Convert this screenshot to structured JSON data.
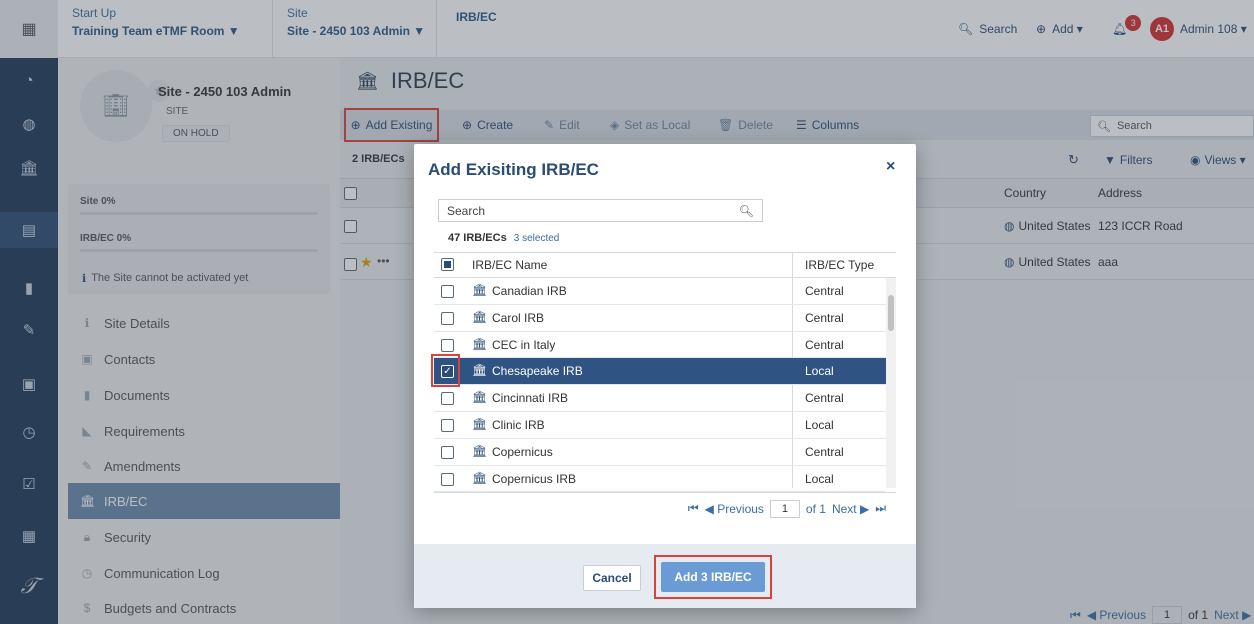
{
  "topbar": {
    "crumbs": [
      {
        "small": "Start Up",
        "big": "Training Team eTMF Room ▼"
      },
      {
        "small": "Site",
        "big": "Site - 2450 103 Admin ▼"
      },
      {
        "small": "",
        "big": "IRB/EC"
      }
    ],
    "search_label": "Search",
    "add_label": "Add ▾",
    "notif_count": "3",
    "avatar_initials": "A1",
    "user_name": "Admin 108 ▾"
  },
  "site": {
    "name": "Site - 2450 103 Admin",
    "type": "SITE",
    "status": "ON HOLD"
  },
  "progress": {
    "site_label": "Site 0%",
    "site_value": 0,
    "irb_label": "IRB/EC 0%",
    "irb_value": 0,
    "notice": "The Site cannot be activated yet"
  },
  "nav": [
    {
      "label": "Site Details",
      "icon": "info-icon"
    },
    {
      "label": "Contacts",
      "icon": "contacts-icon"
    },
    {
      "label": "Documents",
      "icon": "document-icon"
    },
    {
      "label": "Requirements",
      "icon": "tag-icon"
    },
    {
      "label": "Amendments",
      "icon": "edit-icon"
    },
    {
      "label": "IRB/EC",
      "icon": "institution-icon"
    },
    {
      "label": "Security",
      "icon": "lock-icon"
    },
    {
      "label": "Communication Log",
      "icon": "clock-icon"
    },
    {
      "label": "Budgets and Contracts",
      "icon": "dollar-icon"
    }
  ],
  "main": {
    "title": "IRB/EC",
    "toolbar": {
      "add_existing": "Add Existing",
      "create": "Create",
      "edit": "Edit",
      "set_local": "Set as Local",
      "delete": "Delete",
      "columns": "Columns",
      "search_placeholder": "Search"
    },
    "count": "2 IRB/ECs",
    "filters": "Filters",
    "views": "Views ▾",
    "columns": [
      "Country",
      "Address"
    ],
    "rows": [
      {
        "country": "United States",
        "address": "123 ICCR Road"
      },
      {
        "country": "United States",
        "address": "aaa"
      }
    ],
    "pager": {
      "previous": "Previous",
      "page": "1",
      "of": "of 1",
      "next": "Next"
    }
  },
  "modal": {
    "title": "Add Exisiting IRB/EC",
    "close": "×",
    "search_placeholder": "Search",
    "count": "47 IRB/ECs",
    "selected": "3 selected",
    "col_name": "IRB/EC Name",
    "col_type": "IRB/EC Type",
    "rows": [
      {
        "name": "Canadian IRB",
        "type": "Central",
        "checked": false
      },
      {
        "name": "Carol IRB",
        "type": "Central",
        "checked": false
      },
      {
        "name": "CEC in Italy",
        "type": "Central",
        "checked": false
      },
      {
        "name": "Chesapeake IRB",
        "type": "Local",
        "checked": true
      },
      {
        "name": "Cincinnati IRB",
        "type": "Central",
        "checked": false
      },
      {
        "name": "Clinic IRB",
        "type": "Local",
        "checked": false
      },
      {
        "name": "Copernicus",
        "type": "Central",
        "checked": false
      },
      {
        "name": "Copernicus IRB",
        "type": "Local",
        "checked": false
      }
    ],
    "pager": {
      "previous": "Previous",
      "page": "1",
      "of": "of 1",
      "next": "Next"
    },
    "cancel": "Cancel",
    "add": "Add 3 IRB/EC"
  }
}
